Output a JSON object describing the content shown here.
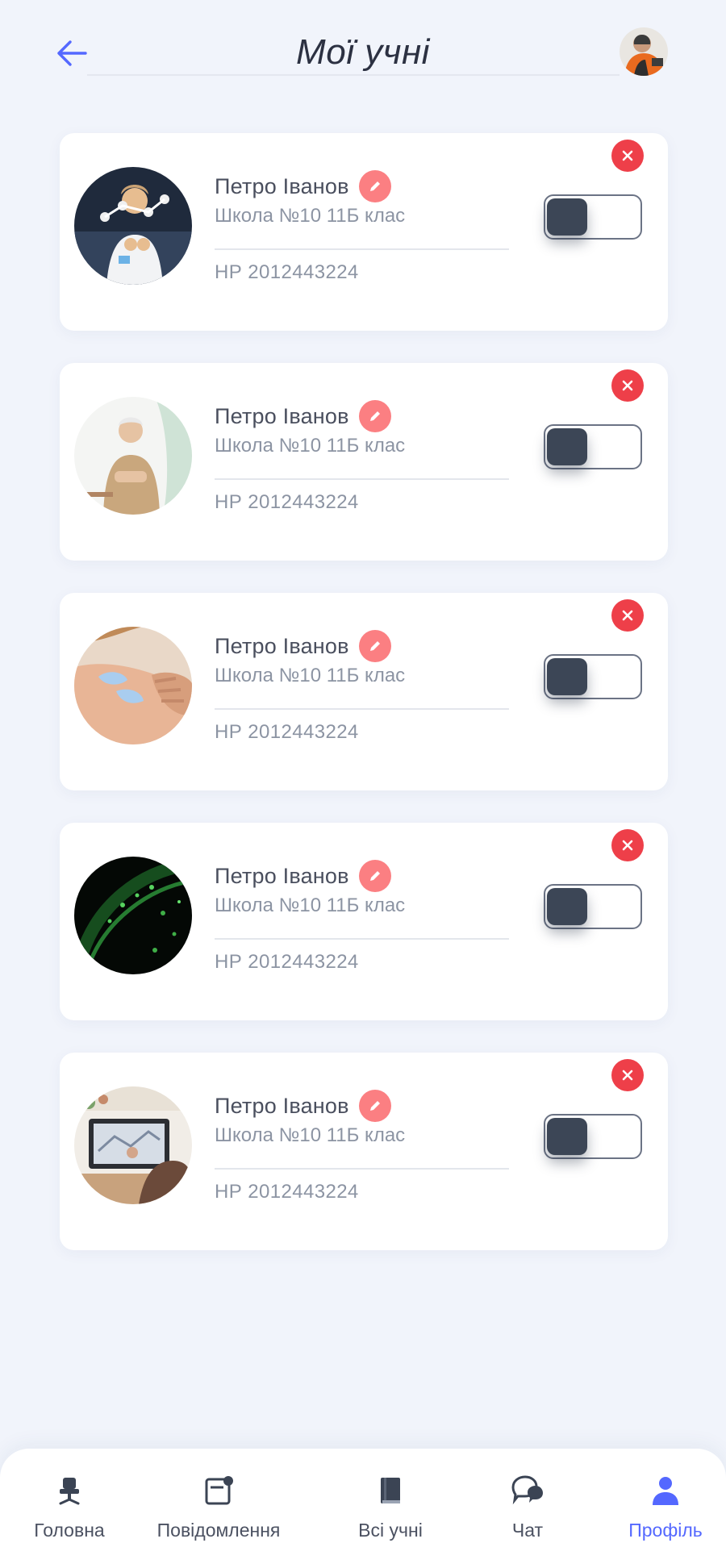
{
  "header": {
    "title": "Мої учні",
    "back_icon": "arrow-left-icon",
    "accent_color": "#5468ff"
  },
  "students": [
    {
      "name": "Петро Іванов",
      "school": "Школа №10 11Б клас",
      "id": "НР 2012443224",
      "photo": "scientist-molecule-model",
      "enabled": false
    },
    {
      "name": "Петро Іванов",
      "school": "Школа №10 11Б клас",
      "id": "НР 2012443224",
      "photo": "elderly-teacher",
      "enabled": false
    },
    {
      "name": "Петро Іванов",
      "school": "Школа №10 11Б клас",
      "id": "НР 2012443224",
      "photo": "shoulder-therapy-tape",
      "enabled": false
    },
    {
      "name": "Петро Іванов",
      "school": "Школа №10 11Б клас",
      "id": "НР 2012443224",
      "photo": "green-particle-sphere",
      "enabled": false
    },
    {
      "name": "Петро Іванов",
      "school": "Школа №10 11Б клас",
      "id": "НР 2012443224",
      "photo": "laptop-on-desk",
      "enabled": false
    }
  ],
  "bottom_nav": {
    "items": [
      {
        "label": "Головна",
        "icon": "desk-chair-icon",
        "active": false
      },
      {
        "label": "Повідомлення",
        "icon": "message-card-icon",
        "active": false
      },
      {
        "label": "Всі учні",
        "icon": "book-icon",
        "active": false
      },
      {
        "label": "Чат",
        "icon": "chat-bubbles-icon",
        "active": false
      },
      {
        "label": "Профіль",
        "icon": "person-icon",
        "active": true
      }
    ]
  },
  "colors": {
    "background": "#f1f4fb",
    "remove": "#ee3f49",
    "edit": "#fb7f82",
    "toggle_knob": "#3c4656",
    "active_nav": "#5468ff"
  }
}
